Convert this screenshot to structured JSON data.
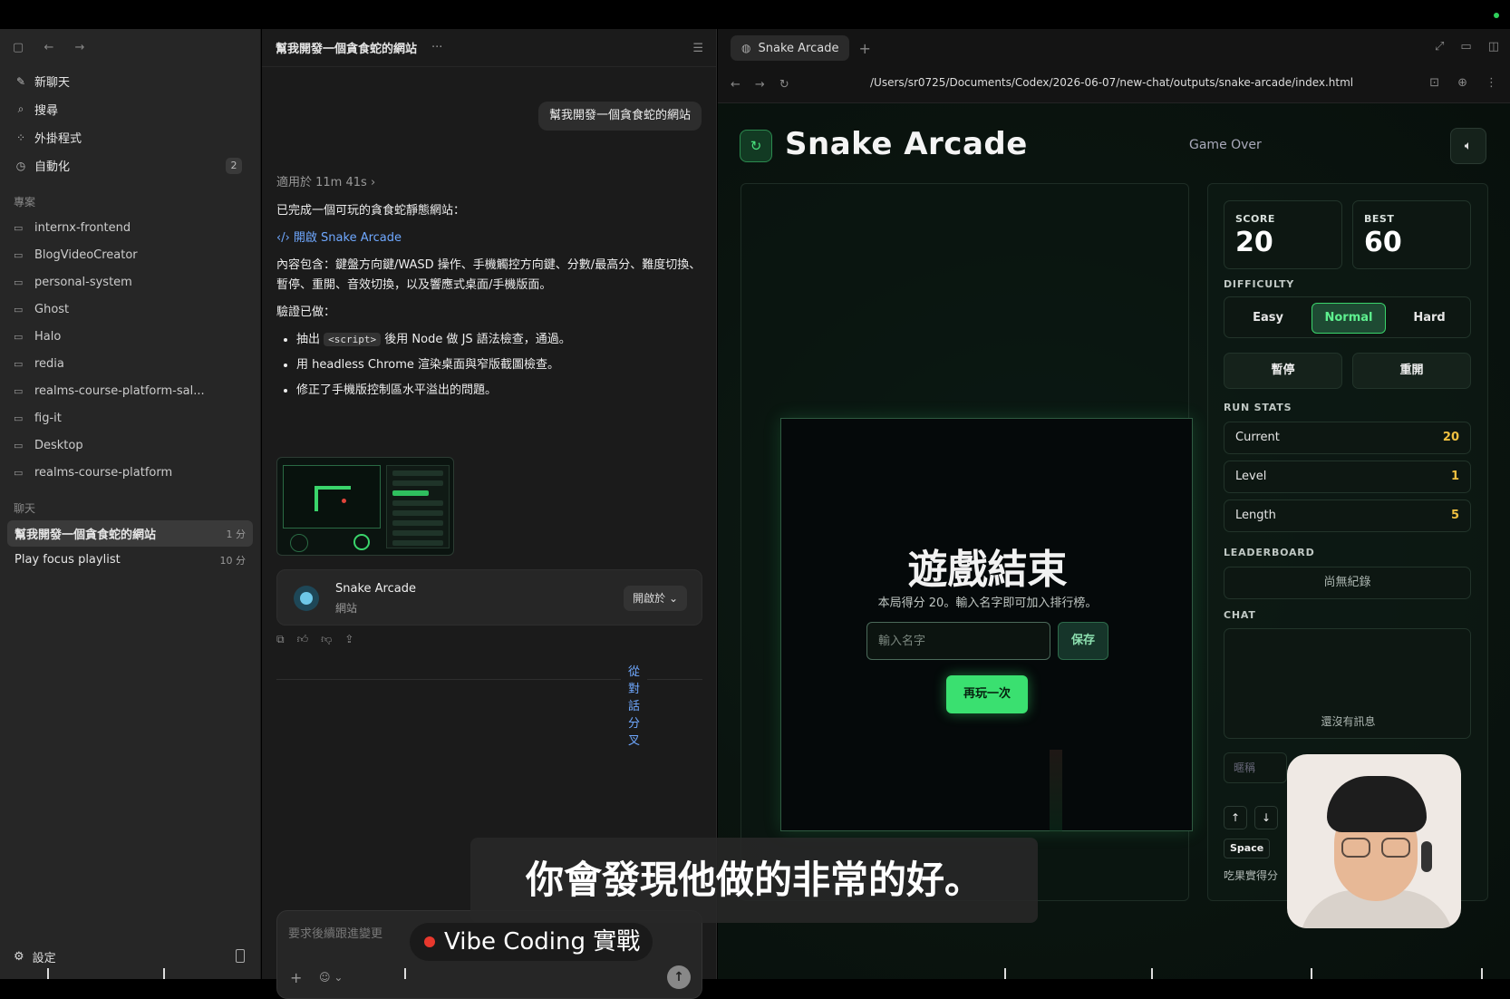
{
  "sidebar": {
    "nav": [
      {
        "label": "新聊天",
        "icon": "edit-icon",
        "glyph": "✎"
      },
      {
        "label": "搜尋",
        "icon": "search-icon",
        "glyph": "⌕"
      },
      {
        "label": "外掛程式",
        "icon": "plugins-icon",
        "glyph": "⁘"
      },
      {
        "label": "自動化",
        "icon": "clock-icon",
        "glyph": "◷",
        "badge": "2"
      }
    ],
    "projects_heading": "專案",
    "projects": [
      "internx-frontend",
      "BlogVideoCreator",
      "personal-system",
      "Ghost",
      "Halo",
      "redia",
      "realms-course-platform-sal...",
      "fig-it",
      "Desktop",
      "realms-course-platform"
    ],
    "chats_heading": "聊天",
    "chats": [
      {
        "title": "幫我開發一個貪食蛇的網站",
        "time": "1 分",
        "active": true
      },
      {
        "title": "Play focus playlist",
        "time": "10 分",
        "active": false
      }
    ],
    "settings_label": "設定"
  },
  "chat": {
    "title": "幫我開發一個貪食蛇的網站",
    "user_message": "幫我開發一個貪食蛇的網站",
    "worked_for": "適用於 11m 41s",
    "intro": "已完成一個可玩的貪食蛇靜態網站：",
    "open_link": "開啟 Snake Arcade",
    "content": "內容包含：鍵盤方向鍵/WASD 操作、手機觸控方向鍵、分數/最高分、難度切換、暫停、重開、音效切換，以及響應式桌面/手機版面。",
    "verified_heading": "驗證已做：",
    "verify_items": [
      {
        "pre": "抽出 ",
        "code": "<script>",
        "post": " 後用 Node 做 JS 語法檢查，通過。"
      },
      {
        "pre": "用 headless Chrome 渲染桌面與窄版截圖檢查。",
        "code": "",
        "post": ""
      },
      {
        "pre": "修正了手機版控制區水平溢出的問題。",
        "code": "",
        "post": ""
      }
    ],
    "card_title": "Snake Arcade",
    "card_subtitle": "網站",
    "card_open": "開啟於",
    "branch_label": "從對話分叉",
    "composer_placeholder": "要求後續跟進變更"
  },
  "browser": {
    "tab_title": "Snake Arcade",
    "url": "/Users/sr0725/Documents/Codex/2026-06-07/new-chat/outputs/snake-arcade/index.html"
  },
  "game": {
    "title": "Snake Arcade",
    "status": "Game Over",
    "over_title": "遊戲結束",
    "over_sub": "本局得分 20。輸入名字即可加入排行榜。",
    "name_placeholder": "輸入名字",
    "save_label": "保存",
    "again_label": "再玩一次",
    "score_label": "SCORE",
    "score": "20",
    "best_label": "BEST",
    "best": "60",
    "difficulty_label": "DIFFICULTY",
    "difficulties": [
      {
        "label": "Easy",
        "active": false
      },
      {
        "label": "Normal",
        "active": true
      },
      {
        "label": "Hard",
        "active": false
      }
    ],
    "pause_label": "暫停",
    "restart_label": "重開",
    "run_stats_label": "RUN STATS",
    "run_stats": [
      {
        "key": "Current",
        "value": "20"
      },
      {
        "key": "Level",
        "value": "1"
      },
      {
        "key": "Length",
        "value": "5"
      }
    ],
    "leaderboard_label": "LEADERBOARD",
    "leaderboard_empty": "尚無紀錄",
    "chat_label": "CHAT",
    "chat_empty": "還沒有訊息",
    "nickname_placeholder": "暱稱",
    "space_key": "Space",
    "hint": "吃果實得分"
  },
  "overlay": {
    "caption": "你會發現他做的非常的好。",
    "live_label": "Vibe Coding 實戰"
  },
  "colors": {
    "accent_green": "#3ae070",
    "stat_value": "#f0c040",
    "link_blue": "#6fa8ff"
  }
}
